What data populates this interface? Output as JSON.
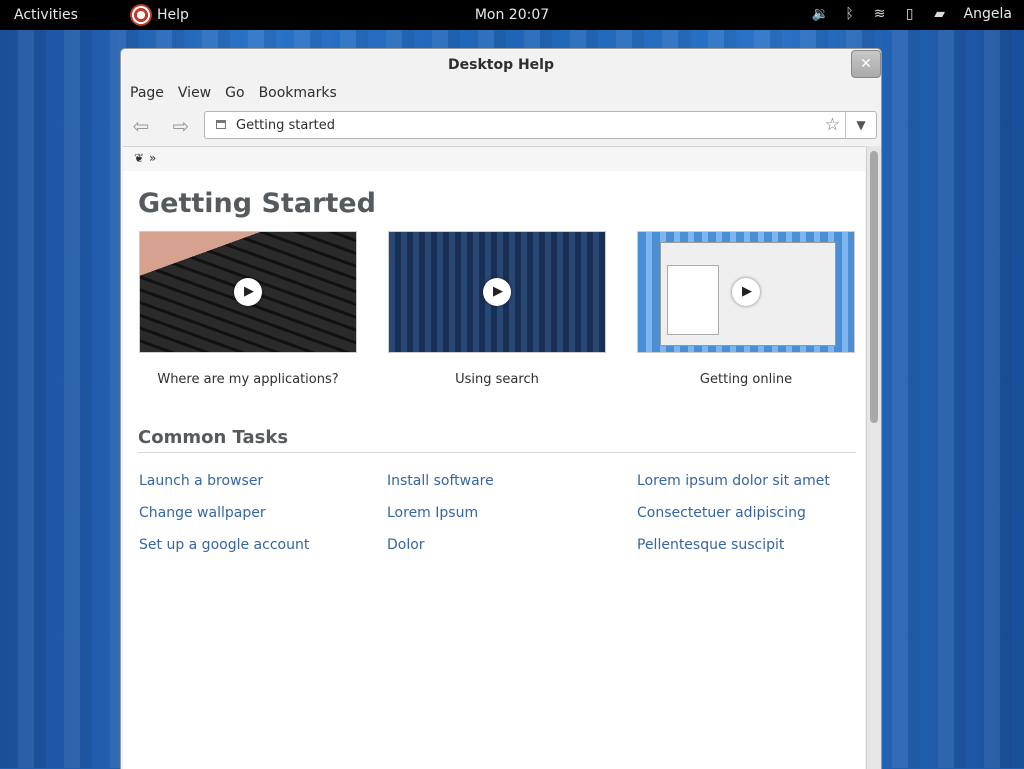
{
  "topbar": {
    "activities": "Activities",
    "app_name": "Help",
    "clock": "Mon 20:07",
    "user": "Angela"
  },
  "window": {
    "title": "Desktop Help",
    "menus": [
      "Page",
      "View",
      "Go",
      "Bookmarks"
    ],
    "location": "Getting started",
    "breadcrumb_sep": "»"
  },
  "content": {
    "page_title": "Getting Started",
    "videos": [
      {
        "caption": "Where are my applications?"
      },
      {
        "caption": "Using search"
      },
      {
        "caption": "Getting online"
      }
    ],
    "section_title": "Common Tasks",
    "tasks": [
      [
        "Launch a browser",
        "Install software",
        "Lorem ipsum dolor sit amet"
      ],
      [
        "Change wallpaper",
        "Lorem Ipsum",
        "Consectetuer adipiscing"
      ],
      [
        "Set up a google account",
        "Dolor",
        "Pellentesque suscipit"
      ]
    ]
  },
  "icons": {
    "app": "lifebuoy-icon",
    "volume": "volume-icon",
    "bluetooth": "bluetooth-icon",
    "wifi": "wifi-icon",
    "battery": "battery-icon",
    "chat": "chat-icon",
    "back": "back-arrow-icon",
    "forward": "forward-arrow-icon",
    "star": "star-icon",
    "dropdown": "chevron-down-icon",
    "close": "close-icon",
    "home": "gnome-foot-icon",
    "play": "play-icon"
  },
  "colors": {
    "link": "#3465a4",
    "heading": "#555a5e",
    "desktop": "#1f5fb0"
  }
}
